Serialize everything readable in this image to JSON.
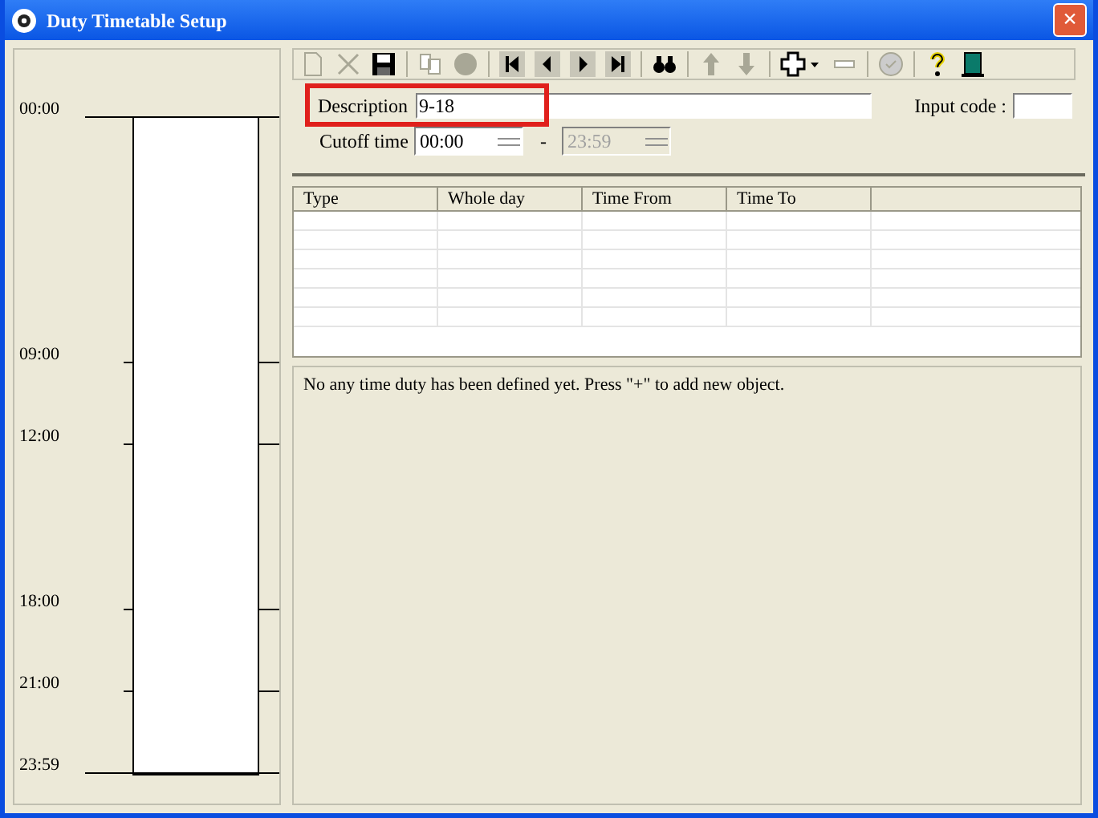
{
  "window": {
    "title": "Duty Timetable Setup",
    "close": "×"
  },
  "timeline": {
    "marks": [
      {
        "label": "00:00"
      },
      {
        "label": "09:00"
      },
      {
        "label": "12:00"
      },
      {
        "label": "18:00"
      },
      {
        "label": "21:00"
      },
      {
        "label": "23:59"
      }
    ]
  },
  "toolbar": [
    {
      "kind": "new",
      "disabled": true
    },
    {
      "kind": "delete",
      "disabled": true
    },
    {
      "kind": "save",
      "disabled": false
    },
    {
      "kind": "sep"
    },
    {
      "kind": "copy",
      "disabled": true
    },
    {
      "kind": "record",
      "disabled": true
    },
    {
      "kind": "sep"
    },
    {
      "kind": "first",
      "disabled": false
    },
    {
      "kind": "prev",
      "disabled": false
    },
    {
      "kind": "next",
      "disabled": false
    },
    {
      "kind": "last",
      "disabled": false
    },
    {
      "kind": "sep"
    },
    {
      "kind": "find",
      "disabled": false
    },
    {
      "kind": "sep"
    },
    {
      "kind": "up",
      "disabled": true
    },
    {
      "kind": "down",
      "disabled": true
    },
    {
      "kind": "sep"
    },
    {
      "kind": "add",
      "disabled": false
    },
    {
      "kind": "remove",
      "disabled": true
    },
    {
      "kind": "sep"
    },
    {
      "kind": "check",
      "disabled": true
    },
    {
      "kind": "sep"
    },
    {
      "kind": "help",
      "disabled": false
    },
    {
      "kind": "exit",
      "disabled": false
    }
  ],
  "form": {
    "description": {
      "label": "Description",
      "value": "9-18",
      "highlighted": true
    },
    "input_code": {
      "label": "Input code :"
    },
    "cutoff": {
      "label": "Cutoff time",
      "from": "00:00",
      "separator": "-",
      "to": "23:59",
      "to_disabled": true
    }
  },
  "table": {
    "columns": [
      "Type",
      "Whole day",
      "Time From",
      "Time To"
    ]
  },
  "message": "No any time duty has been defined yet. Press \"+\" to add new object."
}
